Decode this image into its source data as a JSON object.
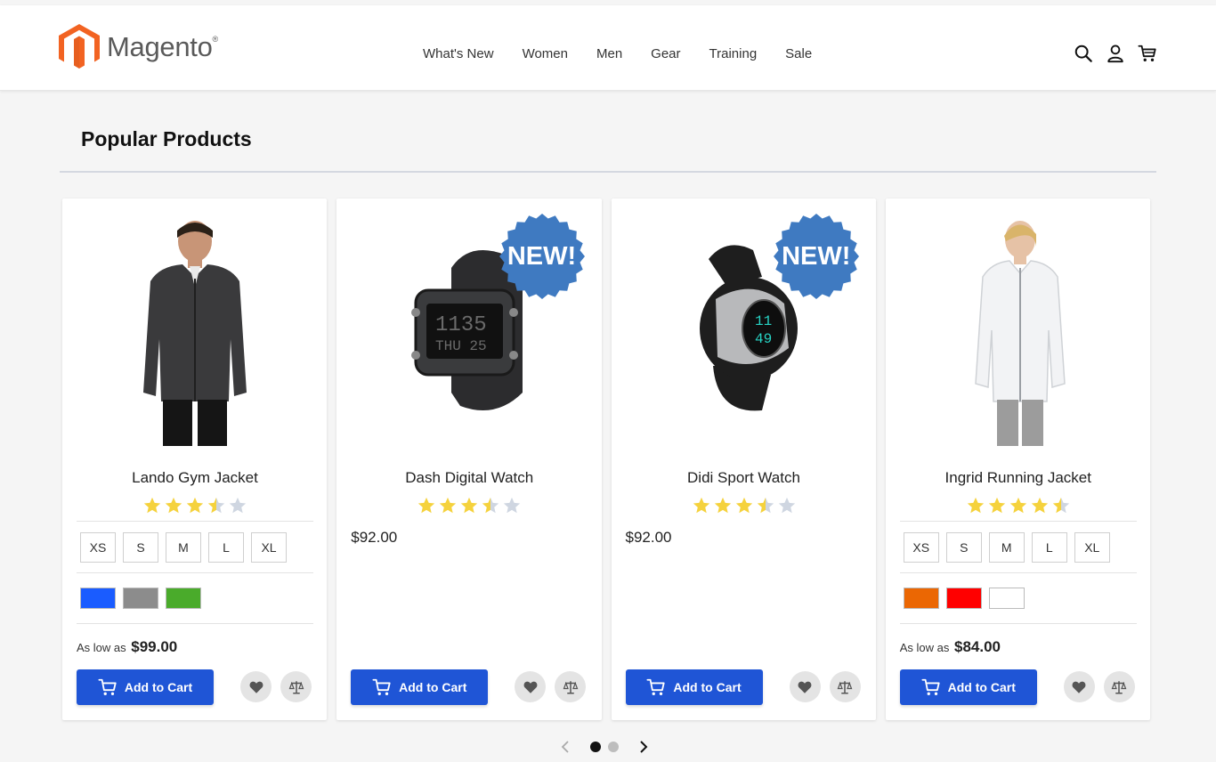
{
  "header": {
    "brand": "Magento",
    "brand_mark": "®",
    "nav": [
      "What's New",
      "Women",
      "Men",
      "Gear",
      "Training",
      "Sale"
    ],
    "icons": [
      "search-icon",
      "account-icon",
      "cart-icon"
    ]
  },
  "section": {
    "title": "Popular Products"
  },
  "colors": {
    "accent": "#1f55d6",
    "badge": "#3f7ac1",
    "star_filled": "#f5d23d",
    "star_empty": "#cfd6e1",
    "logo_orange": "#f26322"
  },
  "products": [
    {
      "name": "Lando Gym Jacket",
      "rating": 3.5,
      "new": false,
      "sizes": [
        "XS",
        "S",
        "M",
        "L",
        "XL"
      ],
      "swatches": [
        "#1a5cff",
        "#8c8c8c",
        "#4aab2b"
      ],
      "price_prefix": "As low as",
      "price": "$99.00",
      "add_to_cart": "Add to Cart"
    },
    {
      "name": "Dash Digital Watch",
      "rating": 3.5,
      "new": true,
      "badge": "NEW!",
      "price": "$92.00",
      "add_to_cart": "Add to Cart"
    },
    {
      "name": "Didi Sport Watch",
      "rating": 3.5,
      "new": true,
      "badge": "NEW!",
      "price": "$92.00",
      "add_to_cart": "Add to Cart"
    },
    {
      "name": "Ingrid Running Jacket",
      "rating": 4.5,
      "new": false,
      "sizes": [
        "XS",
        "S",
        "M",
        "L",
        "XL"
      ],
      "swatches": [
        "#eb6703",
        "#ff0000",
        "#ffffff"
      ],
      "price_prefix": "As low as",
      "price": "$84.00",
      "add_to_cart": "Add to Cart"
    }
  ],
  "pager": {
    "pages": 2,
    "current": 1
  }
}
